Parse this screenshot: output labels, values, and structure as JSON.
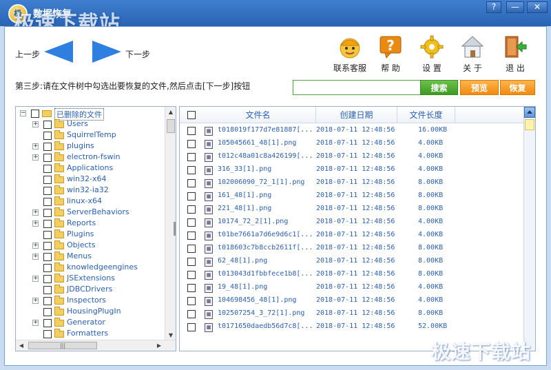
{
  "window": {
    "title": "数据恢复",
    "logo_text": "极",
    "watermark_top": "极速下载站",
    "watermark_bottom": "极速下载站",
    "controls": {
      "help": "?",
      "minimize": "—",
      "close": "✕"
    }
  },
  "nav": {
    "prev_label": "上一步",
    "next_label": "下一步"
  },
  "toolbar": {
    "items": [
      {
        "label": "联系客服",
        "icon": "customer-service-icon"
      },
      {
        "label": "帮  助",
        "icon": "help-icon"
      },
      {
        "label": "设  置",
        "icon": "gear-icon"
      },
      {
        "label": "关  于",
        "icon": "home-icon"
      },
      {
        "label": "退  出",
        "icon": "exit-icon"
      }
    ]
  },
  "step_instruction": "第三步:请在文件树中勾选出要恢复的文件,然后点击[下一步]按钮",
  "search": {
    "value": "",
    "placeholder": ""
  },
  "buttons": {
    "search": "搜索",
    "preview": "预览",
    "recover": "恢复"
  },
  "tree": {
    "root": "已删除的文件",
    "items": [
      {
        "label": "Users",
        "expandable": true
      },
      {
        "label": "SquirrelTemp",
        "expandable": false
      },
      {
        "label": "plugins",
        "expandable": true
      },
      {
        "label": "electron-fswin",
        "expandable": true
      },
      {
        "label": "Applications",
        "expandable": false
      },
      {
        "label": "win32-x64",
        "expandable": false
      },
      {
        "label": "win32-ia32",
        "expandable": false
      },
      {
        "label": "linux-x64",
        "expandable": false
      },
      {
        "label": "ServerBehaviors",
        "expandable": true
      },
      {
        "label": "Reports",
        "expandable": true
      },
      {
        "label": "Plugins",
        "expandable": false
      },
      {
        "label": "Objects",
        "expandable": true
      },
      {
        "label": "Menus",
        "expandable": true
      },
      {
        "label": "knowledgeengines",
        "expandable": false
      },
      {
        "label": "JSExtensions",
        "expandable": true
      },
      {
        "label": "JDBCDrivers",
        "expandable": false
      },
      {
        "label": "Inspectors",
        "expandable": true
      },
      {
        "label": "HousingPlugIn",
        "expandable": false
      },
      {
        "label": "Generator",
        "expandable": true
      },
      {
        "label": "Formatters",
        "expandable": false
      }
    ]
  },
  "file_list": {
    "columns": [
      "文件名",
      "创建日期",
      "文件长度"
    ],
    "rows": [
      {
        "name": "t018019f177d7e81887[...",
        "date": "2018-07-11 12:48:56",
        "size": "16.00KB",
        "icon": "image-file-icon"
      },
      {
        "name": "105045661_48[1].png",
        "date": "2018-07-11 12:48:56",
        "size": "4.00KB",
        "icon": "image-file-icon"
      },
      {
        "name": "t012c48a01c8a426199[...",
        "date": "2018-07-11 12:48:56",
        "size": "4.00KB",
        "icon": "image-file-icon"
      },
      {
        "name": "316_33[1].png",
        "date": "2018-07-11 12:48:56",
        "size": "4.00KB",
        "icon": "image-file-icon"
      },
      {
        "name": "102006090_72_1[1].png",
        "date": "2018-07-11 12:48:56",
        "size": "8.00KB",
        "icon": "image-file-icon"
      },
      {
        "name": "161_48[1].png",
        "date": "2018-07-11 12:48:56",
        "size": "8.00KB",
        "icon": "image-file-icon"
      },
      {
        "name": "221_48[1].png",
        "date": "2018-07-11 12:48:56",
        "size": "8.00KB",
        "icon": "image-file-icon"
      },
      {
        "name": "10174_72_2[1].png",
        "date": "2018-07-11 12:48:56",
        "size": "4.00KB",
        "icon": "image-file-icon"
      },
      {
        "name": "t01be7661a7d6e9d6c1[...",
        "date": "2018-07-11 12:48:56",
        "size": "4.00KB",
        "icon": "image-file-icon"
      },
      {
        "name": "t018603c7b8ccb2611f[...",
        "date": "2018-07-11 12:48:56",
        "size": "8.00KB",
        "icon": "image-file-icon"
      },
      {
        "name": "62_48[1].png",
        "date": "2018-07-11 12:48:56",
        "size": "8.00KB",
        "icon": "image-file-icon"
      },
      {
        "name": "t013043d1fbbfece1b8[...",
        "date": "2018-07-11 12:48:56",
        "size": "8.00KB",
        "icon": "image-file-icon"
      },
      {
        "name": "19_48[1].png",
        "date": "2018-07-11 12:48:56",
        "size": "4.00KB",
        "icon": "image-file-icon"
      },
      {
        "name": "104698456_48[1].png",
        "date": "2018-07-11 12:48:56",
        "size": "4.00KB",
        "icon": "image-file-icon"
      },
      {
        "name": "102507254_3_72[1].png",
        "date": "2018-07-11 12:48:56",
        "size": "8.00KB",
        "icon": "image-file-icon"
      },
      {
        "name": "t0171650daedb56d7c8[...",
        "date": "2018-07-11 12:48:56",
        "size": "52.00KB",
        "icon": "image-file-icon"
      }
    ]
  },
  "colors": {
    "title_bar": "#2a63b3",
    "nav_arrow": "#2f7fe0",
    "search_button": "#3e9a22",
    "action_button": "#f08a10",
    "link_text": "#2a5fb0"
  }
}
